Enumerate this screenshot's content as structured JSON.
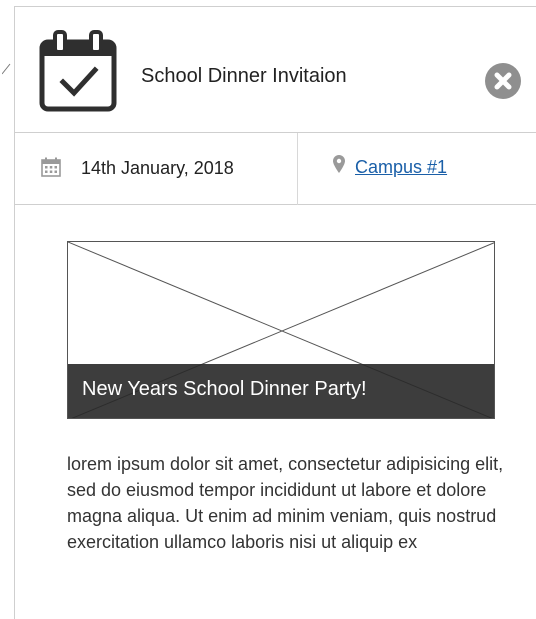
{
  "event": {
    "title": "School Dinner Invitaion",
    "date": "14th January, 2018",
    "location": "Campus #1",
    "image_caption": "New Years School Dinner Party!",
    "description": "lorem ipsum dolor sit amet, consectetur adipisicing elit, sed do eiusmod tempor incididunt ut labore et dolore magna aliqua. Ut enim ad minim veniam, quis nostrud exercitation ullamco laboris nisi ut aliquip ex"
  },
  "icons": {
    "header": "calendar-check-icon",
    "close": "close-circle-icon",
    "date": "calendar-icon",
    "location": "map-pin-icon"
  },
  "colors": {
    "link": "#1a5fa8",
    "caption_bar": "#282828",
    "close_button": "#8f8f8f",
    "divider": "#cfcfcf"
  }
}
